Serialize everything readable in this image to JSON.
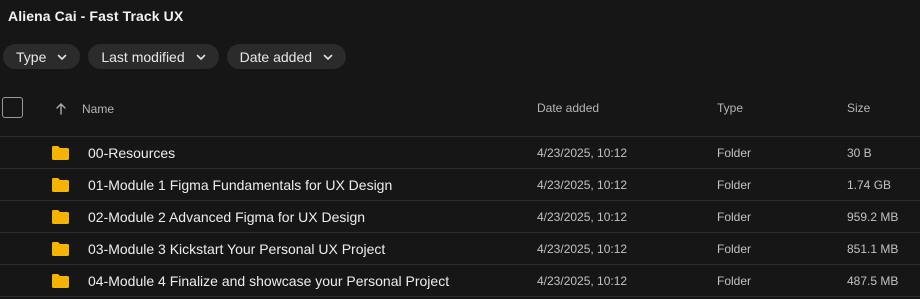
{
  "title": "Aliena Cai - Fast Track UX",
  "filters": [
    {
      "label": "Type",
      "icon": "chevron-down-icon"
    },
    {
      "label": "Last modified",
      "icon": "chevron-down-icon"
    },
    {
      "label": "Date added",
      "icon": "chevron-down-icon"
    }
  ],
  "table": {
    "columns": {
      "name": "Name",
      "date_added": "Date added",
      "type": "Type",
      "size": "Size"
    },
    "sort_icon": "arrow-up-icon",
    "rows": [
      {
        "name": "00-Resources",
        "date_added": "4/23/2025, 10:12",
        "type": "Folder",
        "size": "30 B"
      },
      {
        "name": "01-Module 1 Figma Fundamentals for UX Design",
        "date_added": "4/23/2025, 10:12",
        "type": "Folder",
        "size": "1.74 GB"
      },
      {
        "name": "02-Module 2 Advanced Figma for UX Design",
        "date_added": "4/23/2025, 10:12",
        "type": "Folder",
        "size": "959.2 MB"
      },
      {
        "name": "03-Module 3 Kickstart Your Personal UX Project",
        "date_added": "4/23/2025, 10:12",
        "type": "Folder",
        "size": "851.1 MB"
      },
      {
        "name": "04-Module 4 Finalize and showcase your Personal Project",
        "date_added": "4/23/2025, 10:12",
        "type": "Folder",
        "size": "487.5 MB"
      }
    ]
  },
  "colors": {
    "background": "#161616",
    "chip": "#2b2b2b",
    "folder": "#f5b400"
  }
}
